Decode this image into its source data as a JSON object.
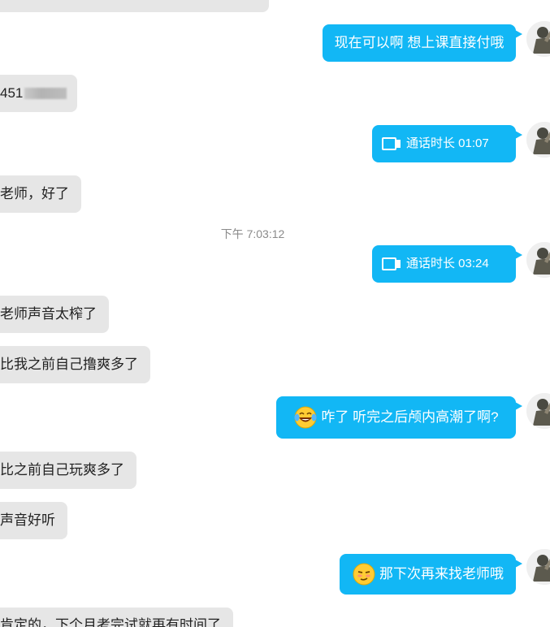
{
  "messages": {
    "m1_text": "",
    "m2_text": "现在可以啊 想上课直接付哦",
    "m3_text": "451",
    "m4_text": "通话时长 01:07",
    "m5_text": "老师，好了",
    "timestamp": "下午 7:03:12",
    "m6_text": "通话时长 03:24",
    "m7_text": "老师声音太榨了",
    "m8_text": "比我之前自己撸爽多了",
    "m9_text": "咋了  听完之后颅内高潮了啊?",
    "m10_text": "比之前自己玩爽多了",
    "m11_text": "声音好听",
    "m12_text": "那下次再来找老师哦",
    "m13_text": "肯定的，下个月考完试就再有时间了"
  },
  "icons": {
    "call": "video-call-icon",
    "laugh": "tears-of-joy-emoji-icon",
    "smirk": "smirk-emoji-icon",
    "avatar": "user-avatar"
  },
  "colors": {
    "outgoing_bubble": "#12b7f5",
    "incoming_bubble": "#e6e6e6",
    "timestamp_text": "#8a8a8a"
  }
}
